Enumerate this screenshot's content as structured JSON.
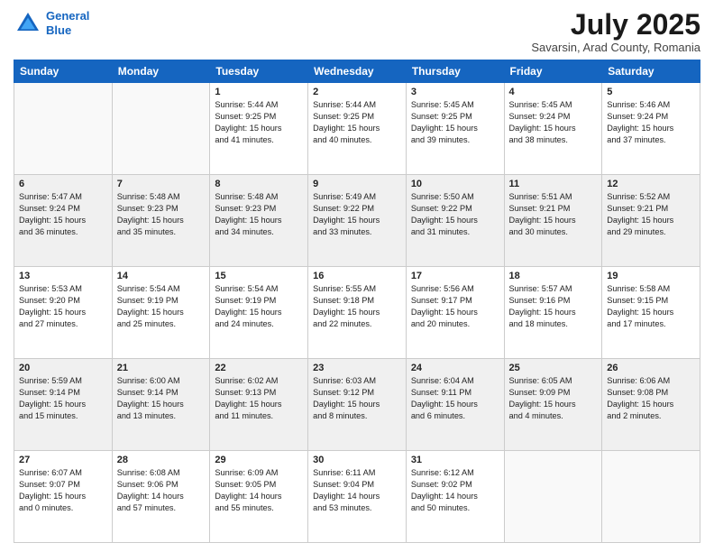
{
  "header": {
    "logo_line1": "General",
    "logo_line2": "Blue",
    "title": "July 2025",
    "subtitle": "Savarsin, Arad County, Romania"
  },
  "weekdays": [
    "Sunday",
    "Monday",
    "Tuesday",
    "Wednesday",
    "Thursday",
    "Friday",
    "Saturday"
  ],
  "weeks": [
    [
      {
        "day": "",
        "info": "",
        "empty": true
      },
      {
        "day": "",
        "info": "",
        "empty": true
      },
      {
        "day": "1",
        "info": "Sunrise: 5:44 AM\nSunset: 9:25 PM\nDaylight: 15 hours\nand 41 minutes."
      },
      {
        "day": "2",
        "info": "Sunrise: 5:44 AM\nSunset: 9:25 PM\nDaylight: 15 hours\nand 40 minutes."
      },
      {
        "day": "3",
        "info": "Sunrise: 5:45 AM\nSunset: 9:25 PM\nDaylight: 15 hours\nand 39 minutes."
      },
      {
        "day": "4",
        "info": "Sunrise: 5:45 AM\nSunset: 9:24 PM\nDaylight: 15 hours\nand 38 minutes."
      },
      {
        "day": "5",
        "info": "Sunrise: 5:46 AM\nSunset: 9:24 PM\nDaylight: 15 hours\nand 37 minutes."
      }
    ],
    [
      {
        "day": "6",
        "info": "Sunrise: 5:47 AM\nSunset: 9:24 PM\nDaylight: 15 hours\nand 36 minutes.",
        "shaded": true
      },
      {
        "day": "7",
        "info": "Sunrise: 5:48 AM\nSunset: 9:23 PM\nDaylight: 15 hours\nand 35 minutes.",
        "shaded": true
      },
      {
        "day": "8",
        "info": "Sunrise: 5:48 AM\nSunset: 9:23 PM\nDaylight: 15 hours\nand 34 minutes.",
        "shaded": true
      },
      {
        "day": "9",
        "info": "Sunrise: 5:49 AM\nSunset: 9:22 PM\nDaylight: 15 hours\nand 33 minutes.",
        "shaded": true
      },
      {
        "day": "10",
        "info": "Sunrise: 5:50 AM\nSunset: 9:22 PM\nDaylight: 15 hours\nand 31 minutes.",
        "shaded": true
      },
      {
        "day": "11",
        "info": "Sunrise: 5:51 AM\nSunset: 9:21 PM\nDaylight: 15 hours\nand 30 minutes.",
        "shaded": true
      },
      {
        "day": "12",
        "info": "Sunrise: 5:52 AM\nSunset: 9:21 PM\nDaylight: 15 hours\nand 29 minutes.",
        "shaded": true
      }
    ],
    [
      {
        "day": "13",
        "info": "Sunrise: 5:53 AM\nSunset: 9:20 PM\nDaylight: 15 hours\nand 27 minutes."
      },
      {
        "day": "14",
        "info": "Sunrise: 5:54 AM\nSunset: 9:19 PM\nDaylight: 15 hours\nand 25 minutes."
      },
      {
        "day": "15",
        "info": "Sunrise: 5:54 AM\nSunset: 9:19 PM\nDaylight: 15 hours\nand 24 minutes."
      },
      {
        "day": "16",
        "info": "Sunrise: 5:55 AM\nSunset: 9:18 PM\nDaylight: 15 hours\nand 22 minutes."
      },
      {
        "day": "17",
        "info": "Sunrise: 5:56 AM\nSunset: 9:17 PM\nDaylight: 15 hours\nand 20 minutes."
      },
      {
        "day": "18",
        "info": "Sunrise: 5:57 AM\nSunset: 9:16 PM\nDaylight: 15 hours\nand 18 minutes."
      },
      {
        "day": "19",
        "info": "Sunrise: 5:58 AM\nSunset: 9:15 PM\nDaylight: 15 hours\nand 17 minutes."
      }
    ],
    [
      {
        "day": "20",
        "info": "Sunrise: 5:59 AM\nSunset: 9:14 PM\nDaylight: 15 hours\nand 15 minutes.",
        "shaded": true
      },
      {
        "day": "21",
        "info": "Sunrise: 6:00 AM\nSunset: 9:14 PM\nDaylight: 15 hours\nand 13 minutes.",
        "shaded": true
      },
      {
        "day": "22",
        "info": "Sunrise: 6:02 AM\nSunset: 9:13 PM\nDaylight: 15 hours\nand 11 minutes.",
        "shaded": true
      },
      {
        "day": "23",
        "info": "Sunrise: 6:03 AM\nSunset: 9:12 PM\nDaylight: 15 hours\nand 8 minutes.",
        "shaded": true
      },
      {
        "day": "24",
        "info": "Sunrise: 6:04 AM\nSunset: 9:11 PM\nDaylight: 15 hours\nand 6 minutes.",
        "shaded": true
      },
      {
        "day": "25",
        "info": "Sunrise: 6:05 AM\nSunset: 9:09 PM\nDaylight: 15 hours\nand 4 minutes.",
        "shaded": true
      },
      {
        "day": "26",
        "info": "Sunrise: 6:06 AM\nSunset: 9:08 PM\nDaylight: 15 hours\nand 2 minutes.",
        "shaded": true
      }
    ],
    [
      {
        "day": "27",
        "info": "Sunrise: 6:07 AM\nSunset: 9:07 PM\nDaylight: 15 hours\nand 0 minutes."
      },
      {
        "day": "28",
        "info": "Sunrise: 6:08 AM\nSunset: 9:06 PM\nDaylight: 14 hours\nand 57 minutes."
      },
      {
        "day": "29",
        "info": "Sunrise: 6:09 AM\nSunset: 9:05 PM\nDaylight: 14 hours\nand 55 minutes."
      },
      {
        "day": "30",
        "info": "Sunrise: 6:11 AM\nSunset: 9:04 PM\nDaylight: 14 hours\nand 53 minutes."
      },
      {
        "day": "31",
        "info": "Sunrise: 6:12 AM\nSunset: 9:02 PM\nDaylight: 14 hours\nand 50 minutes."
      },
      {
        "day": "",
        "info": "",
        "empty": true
      },
      {
        "day": "",
        "info": "",
        "empty": true
      }
    ]
  ]
}
